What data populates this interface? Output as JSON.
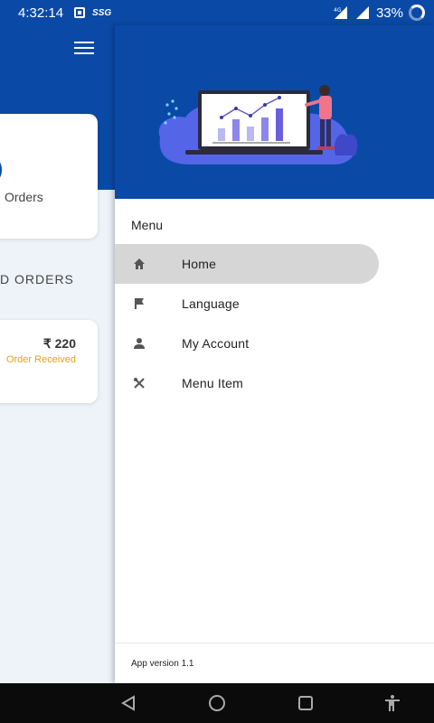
{
  "status_bar": {
    "time": "4:32:14",
    "carrier_badge": "SSG",
    "battery_percent": "33%",
    "network_badge": "4G"
  },
  "background_screen": {
    "card1_text": "Orders",
    "section_title": "D ORDERS",
    "order_card": {
      "amount": "₹ 220",
      "status": "Order Received",
      "status_color": "#e5a21c"
    }
  },
  "drawer": {
    "menu_title": "Menu",
    "items": [
      {
        "label": "Home",
        "icon": "home-icon",
        "active": true
      },
      {
        "label": "Language",
        "icon": "flag-icon",
        "active": false
      },
      {
        "label": "My Account",
        "icon": "person-icon",
        "active": false
      },
      {
        "label": "Menu Item",
        "icon": "fork-knife-icon",
        "active": false
      }
    ],
    "app_version": "App version 1.1"
  },
  "colors": {
    "primary": "#0a4aa6",
    "active_item_bg": "#d6d6d6",
    "background": "#eef2f9"
  },
  "navbar": {
    "buttons": [
      "back-icon",
      "home-circle-icon",
      "recents-icon",
      "accessibility-icon"
    ]
  }
}
